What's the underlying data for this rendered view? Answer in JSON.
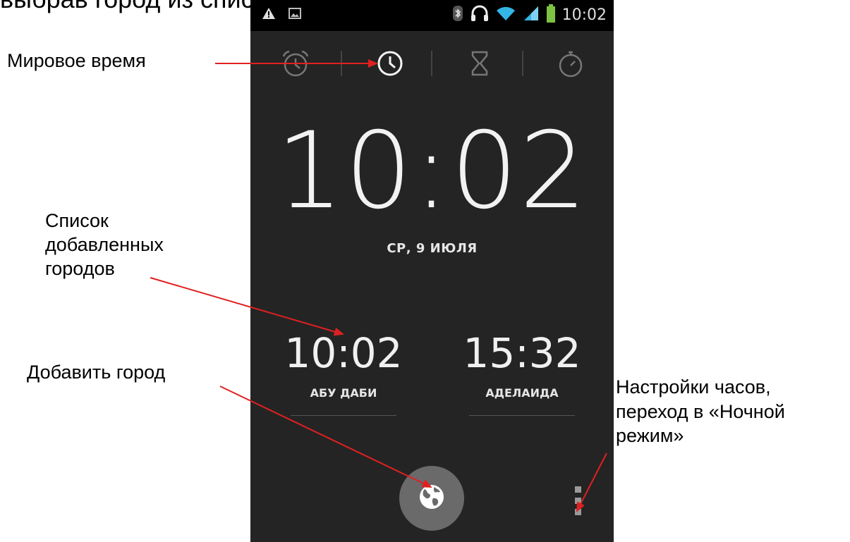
{
  "top_caption": "выбрав город из списка:",
  "status_bar": {
    "time": "10:02",
    "left_icons": [
      "warning-icon",
      "image-icon"
    ],
    "right_icons": [
      "bluetooth-icon",
      "headphones-icon",
      "wifi-icon",
      "signal-icon",
      "battery-icon"
    ],
    "accent_color": "#33b5e5",
    "signal_color": "#33b5e5",
    "battery_color": "#7dc242"
  },
  "tabs": [
    {
      "name": "alarm",
      "icon": "alarm-clock-icon",
      "active": false
    },
    {
      "name": "clock",
      "icon": "clock-icon",
      "active": true
    },
    {
      "name": "timer",
      "icon": "hourglass-icon",
      "active": false
    },
    {
      "name": "stopwatch",
      "icon": "stopwatch-icon",
      "active": false
    }
  ],
  "main_clock": {
    "time": "10:02",
    "date": "СР, 9 ИЮЛЯ"
  },
  "cities": [
    {
      "time": "10:02",
      "name": "АБУ ДАБИ"
    },
    {
      "time": "15:32",
      "name": "АДЕЛАИДА"
    }
  ],
  "fab": {
    "icon": "globe-icon"
  },
  "overflow": {
    "icon": "overflow-menu-icon"
  },
  "annotations": {
    "world_time": "Мировое время",
    "city_list": "Список\nдобавленных\nгородов",
    "add_city": "Добавить город",
    "settings": "Настройки часов,\nпереход в «Ночной\nрежим»"
  },
  "colors": {
    "arrow": "#e02020",
    "screen_bg": "#242424",
    "fab_bg": "#6a6a6a"
  }
}
